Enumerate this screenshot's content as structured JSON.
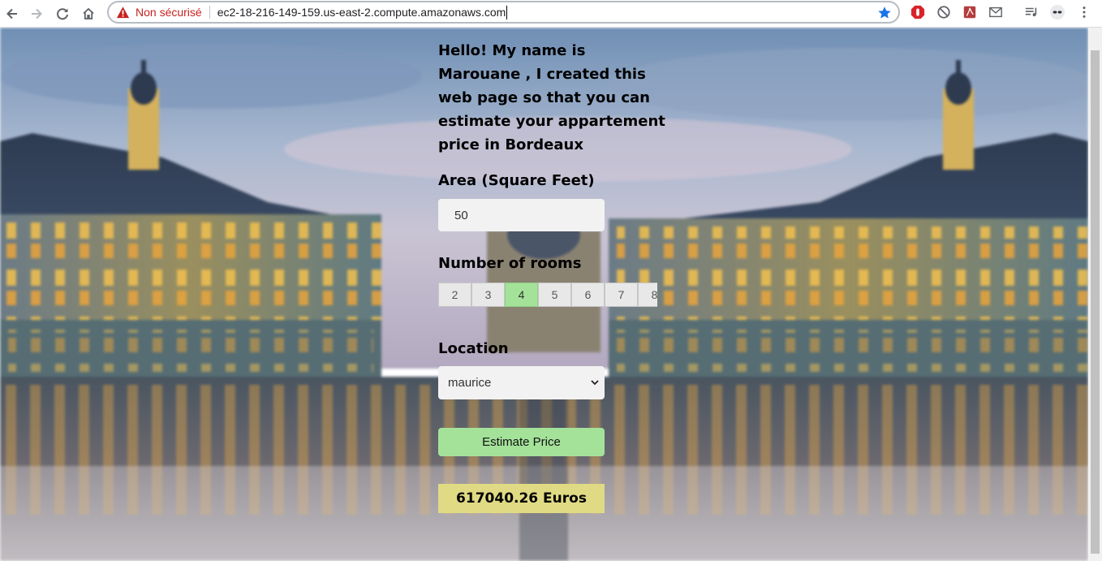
{
  "browser": {
    "security_label": "Non sécurisé",
    "url": "ec2-18-216-149-159.us-east-2.compute.amazonaws.com"
  },
  "page": {
    "intro_text": "Hello! My name is Marouane , I created this web page so that you can estimate your appartement price in Bordeaux",
    "area": {
      "label": "Area (Square Feet)",
      "value": "50"
    },
    "rooms": {
      "label": "Number of rooms",
      "options": [
        "2",
        "3",
        "4",
        "5",
        "6",
        "7",
        "8"
      ],
      "selected": "4"
    },
    "location": {
      "label": "Location",
      "selected": "maurice"
    },
    "estimate_button": "Estimate Price",
    "result": "617040.26 Euros"
  },
  "colors": {
    "accent_green": "#a4e29a",
    "result_bg": "#e0da84",
    "insecure_red": "#c5221f",
    "star_blue": "#1a73e8"
  }
}
